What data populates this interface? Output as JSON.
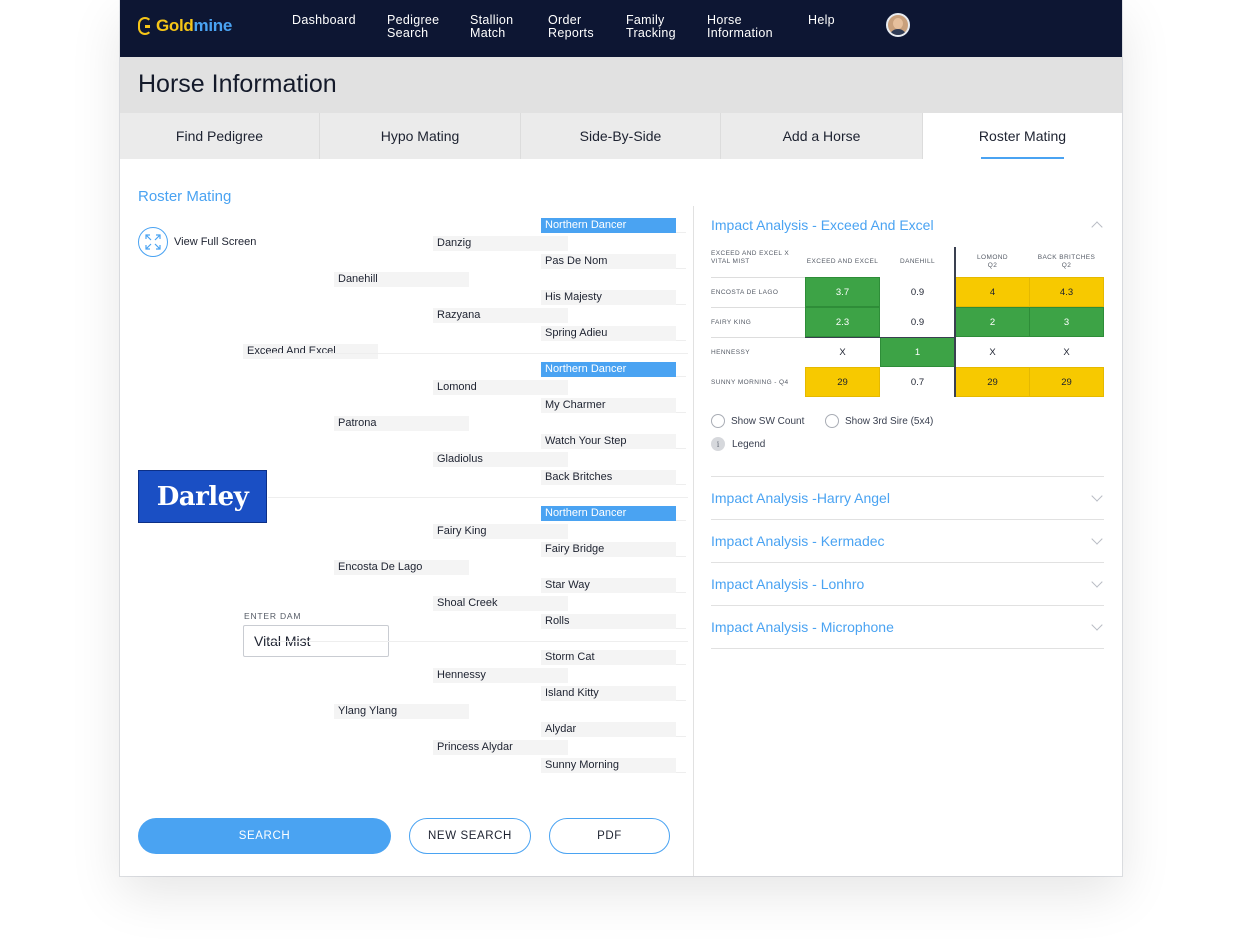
{
  "brand": {
    "gold": "Gold",
    "mine": "mine"
  },
  "nav": {
    "dashboard": "Dashboard",
    "pedigree_search": "Pedigree\nSearch",
    "stallion_match": "Stallion\nMatch",
    "order_reports": "Order\nReports",
    "family_tracking": "Family\nTracking",
    "horse_information": "Horse\nInformation",
    "help": "Help"
  },
  "page_title": "Horse Information",
  "tabs": {
    "find_pedigree": "Find Pedigree",
    "hypo_mating": "Hypo Mating",
    "side_by_side": "Side-By-Side",
    "add_a_horse": "Add a Horse",
    "roster_mating": "Roster Mating"
  },
  "left": {
    "section_title": "Roster Mating",
    "view_full_screen": "View Full Screen",
    "sire_logo_text": "Darley",
    "enter_dam_label": "ENTER DAM",
    "dam_value": "Vital Mist",
    "search_button": "SEARCH",
    "new_search_button": "NEW SEARCH",
    "pdf_button": "PDF"
  },
  "pedigree": {
    "gen1": [
      "Exceed And Excel"
    ],
    "gen2": [
      "Danehill",
      "Patrona",
      "Encosta De Lago",
      "Ylang Ylang"
    ],
    "gen3": [
      "Danzig",
      "Razyana",
      "Lomond",
      "Gladiolus",
      "Fairy King",
      "Shoal Creek",
      "Hennessy",
      "Princess Alydar"
    ],
    "gen4": [
      "Northern Dancer",
      "Pas De Nom",
      "His Majesty",
      "Spring Adieu",
      "Northern Dancer",
      "My Charmer",
      "Watch Your Step",
      "Back Britches",
      "Northern Dancer",
      "Fairy Bridge",
      "Star Way",
      "Rolls",
      "Storm Cat",
      "Island Kitty",
      "Alydar",
      "Sunny Morning"
    ],
    "gen4_highlighted": [
      true,
      false,
      false,
      false,
      true,
      false,
      false,
      false,
      true,
      false,
      false,
      false,
      false,
      false,
      false,
      false
    ]
  },
  "impact": {
    "open_title": "Impact Analysis - Exceed And Excel",
    "corner_header": "EXCEED AND EXCEL X VITAL MIST",
    "columns": [
      "EXCEED AND EXCEL",
      "DANEHILL",
      "LOMOND\nQ2",
      "BACK BRITCHES\nQ2"
    ],
    "rows": [
      {
        "label": "ENCOSTA DE LAGO",
        "values": [
          "3.7",
          "0.9",
          "4",
          "4.3"
        ],
        "colors": [
          "green",
          "white",
          "yellow",
          "yellow"
        ]
      },
      {
        "label": "FAIRY KING",
        "values": [
          "2.3",
          "0.9",
          "2",
          "3"
        ],
        "colors": [
          "green",
          "white",
          "green",
          "green"
        ]
      },
      {
        "label": "HENNESSY",
        "values": [
          "X",
          "1",
          "X",
          "X"
        ],
        "colors": [
          "white",
          "green",
          "white",
          "white"
        ]
      },
      {
        "label": "SUNNY MORNING - Q4",
        "values": [
          "29",
          "0.7",
          "29",
          "29"
        ],
        "colors": [
          "yellow",
          "white",
          "yellow",
          "yellow"
        ]
      }
    ],
    "show_sw_count": "Show SW Count",
    "show_3rd_sire": "Show 3rd Sire (5x4)",
    "legend": "Legend",
    "legend_icon_glyph": "i",
    "collapsed": [
      "Impact Analysis -Harry Angel",
      "Impact Analysis - Kermadec",
      "Impact Analysis - Lonhro",
      "Impact Analysis - Microphone"
    ]
  },
  "colors": {
    "accent": "#4aa3f2",
    "nav_bg": "#0d1633",
    "green": "#3da346",
    "yellow": "#f7c900",
    "logo_gold": "#f5c518"
  }
}
